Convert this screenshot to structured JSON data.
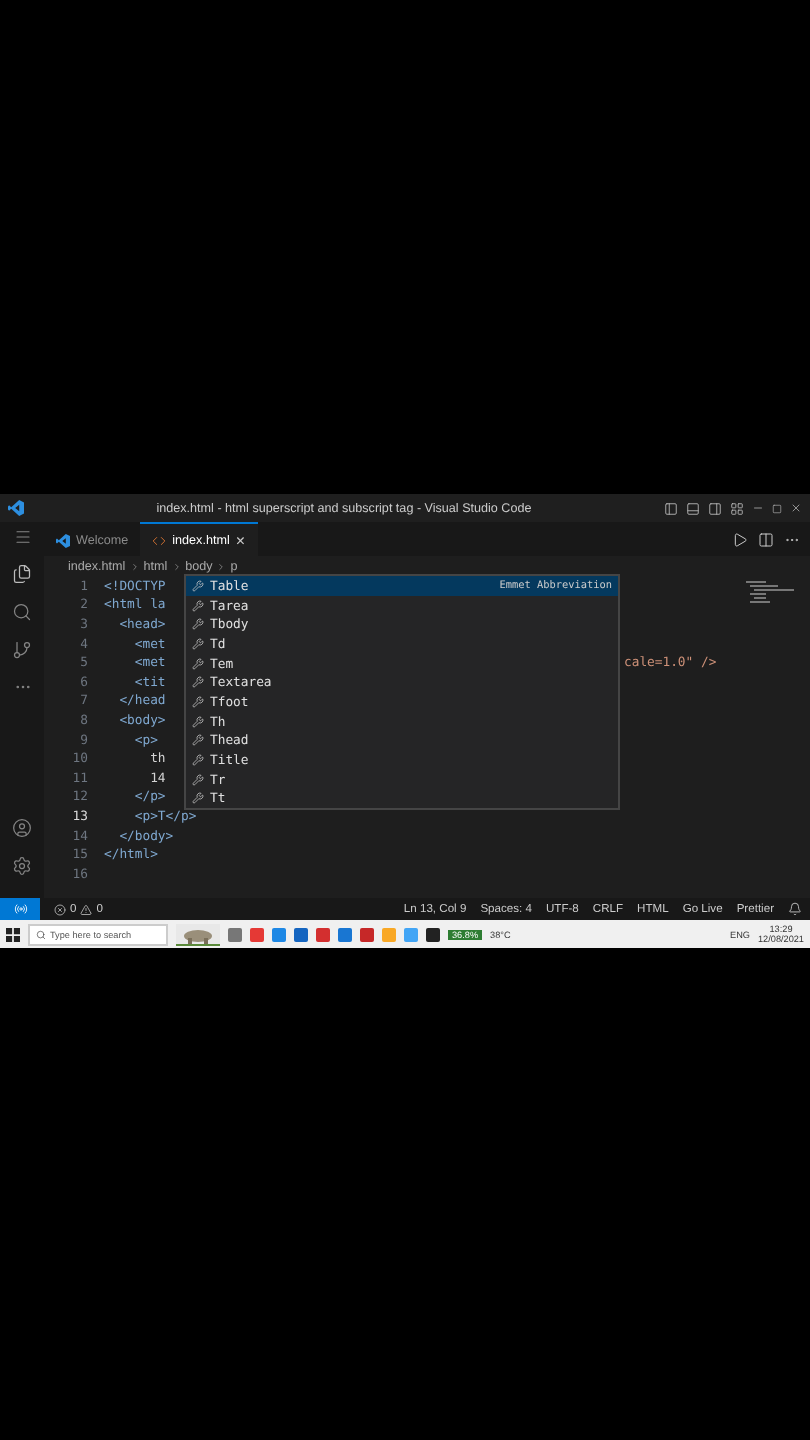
{
  "window": {
    "title": "index.html - html superscript and subscript tag - Visual Studio Code"
  },
  "tabs": [
    {
      "label": "Welcome",
      "kind": "welcome",
      "selected": false
    },
    {
      "label": "index.html",
      "kind": "html",
      "selected": true,
      "close": "×"
    }
  ],
  "breadcrumbs": [
    "index.html",
    "html",
    "body",
    "p"
  ],
  "editor": {
    "lines": [
      {
        "number": "1",
        "kind": "tag",
        "text": "<!DOCTYP"
      },
      {
        "number": "2",
        "kind": "tag",
        "text": "<html la"
      },
      {
        "number": "3",
        "kind": "tag",
        "text": "  <head>"
      },
      {
        "number": "4",
        "kind": "tag",
        "text": "    <met"
      },
      {
        "number": "5",
        "kind": "tag",
        "text": "    <met",
        "tail": "cale=1.0\" />"
      },
      {
        "number": "6",
        "kind": "tag",
        "text": "    <tit"
      },
      {
        "number": "7",
        "kind": "tag",
        "text": "  </head"
      },
      {
        "number": "8",
        "kind": "tag",
        "text": "  <body>"
      },
      {
        "number": "9",
        "kind": "tag",
        "text": "    <p>"
      },
      {
        "number": "10",
        "kind": "text",
        "text": "      th"
      },
      {
        "number": "11",
        "kind": "text",
        "text": "      14"
      },
      {
        "number": "12",
        "kind": "tag",
        "text": "    </p>"
      },
      {
        "number": "13",
        "kind": "tag",
        "text": "    <p>T</p>",
        "current": true
      },
      {
        "number": "14",
        "kind": "tag",
        "text": "  </body>"
      },
      {
        "number": "15",
        "kind": "tag",
        "text": "</html>"
      },
      {
        "number": "16"
      }
    ]
  },
  "suggestions": {
    "detail": "Emmet Abbreviation",
    "items": [
      {
        "label": "Table",
        "selected": true
      },
      {
        "label": "Tarea",
        "selected": false
      },
      {
        "label": "Tbody",
        "selected": false
      },
      {
        "label": "Td",
        "selected": false
      },
      {
        "label": "Tem",
        "selected": false
      },
      {
        "label": "Textarea",
        "selected": false
      },
      {
        "label": "Tfoot",
        "selected": false
      },
      {
        "label": "Th",
        "selected": false
      },
      {
        "label": "Thead",
        "selected": false
      },
      {
        "label": "Title",
        "selected": false
      },
      {
        "label": "Tr",
        "selected": false
      },
      {
        "label": "Tt",
        "selected": false
      }
    ]
  },
  "status_bar": {
    "errors": "0",
    "warnings": "0",
    "items": [
      "Ln 13, Col 9",
      "Spaces: 4",
      "UTF-8",
      "CRLF",
      "HTML",
      "Go Live",
      "Prettier"
    ]
  },
  "taskbar": {
    "search_placeholder": "Type here to search",
    "battery": "36.8%",
    "weather": "38°C",
    "language": "ENG",
    "time": "13:29",
    "date": "12/08/2021"
  }
}
